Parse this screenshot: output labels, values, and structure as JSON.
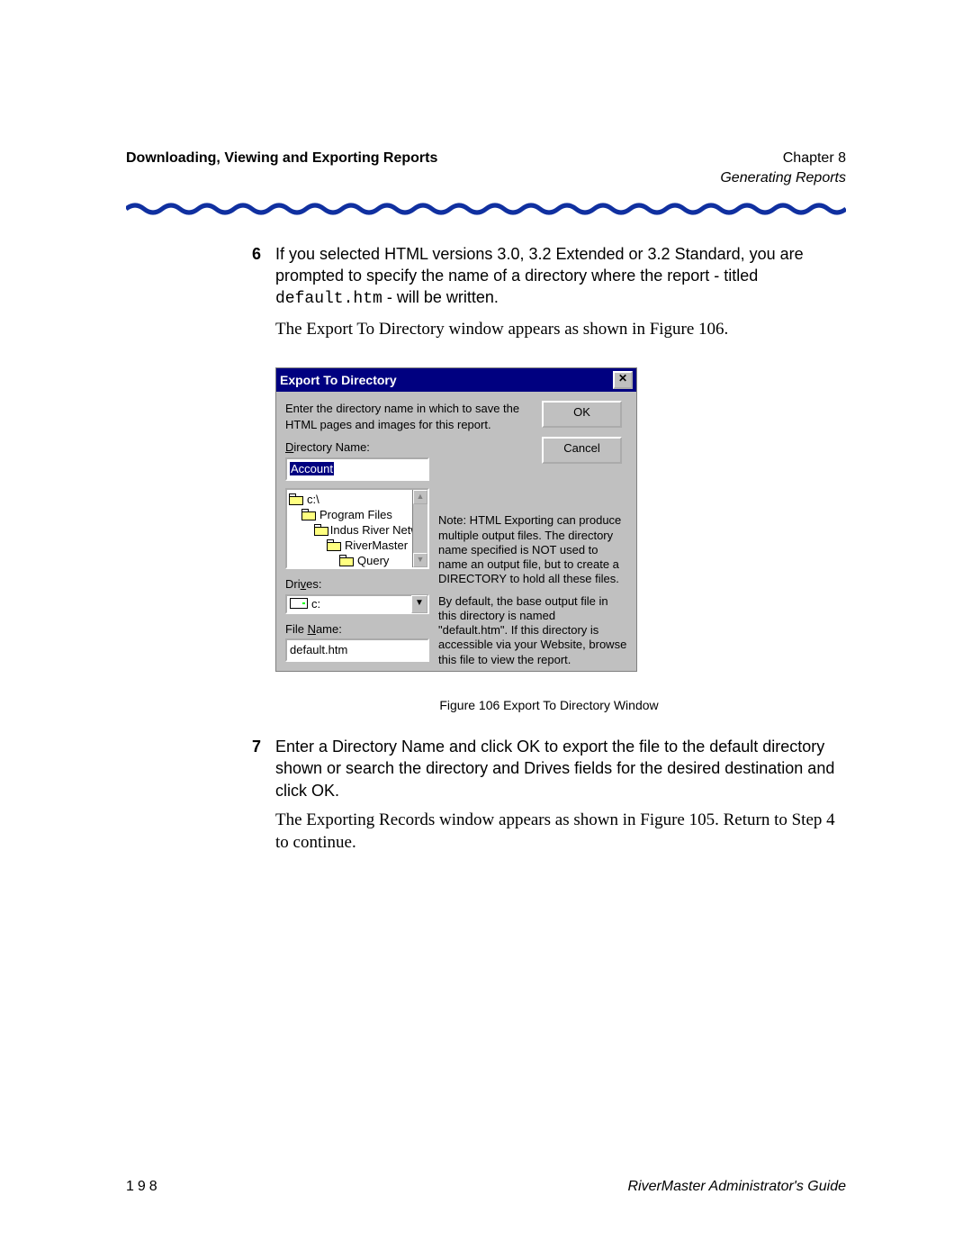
{
  "header": {
    "left": "Downloading, Viewing and Exporting Reports",
    "right_top": "Chapter 8",
    "right_sub": "Generating Reports"
  },
  "steps": {
    "s6": {
      "num": "6",
      "p1_a": "If you selected HTML versions 3.0, 3.2 Extended or 3.2 Standard, you are prompted to specify the name of a directory where the report - titled ",
      "p1_code": "default.htm",
      "p1_b": " - will be written.",
      "p2": "The Export To Directory window appears as shown in Figure 106."
    },
    "s7": {
      "num": "7",
      "p1": "Enter a Directory Name and click OK to export the file to the default directory shown or search the directory and Drives fields for the desired destination and click OK.",
      "p2": "The Exporting Records window appears as shown in Figure 105. Return to Step 4 to continue."
    }
  },
  "dialog": {
    "title": "Export To Directory",
    "instruction": "Enter the directory name in which to save the HTML pages and images for this report.",
    "ok": "OK",
    "cancel": "Cancel",
    "dir_label_pre": "D",
    "dir_label_post": "irectory Name:",
    "dir_value": "Account",
    "tree": {
      "root": "c:\\",
      "l1": "Program Files",
      "l2": "Indus River Netwo",
      "l3": "RiverMaster",
      "l4": "Query"
    },
    "drives_label_pre": "Dri",
    "drives_label_u": "v",
    "drives_label_post": "es:",
    "drive_value": "c:",
    "filename_label_pre": "File ",
    "filename_label_u": "N",
    "filename_label_post": "ame:",
    "filename_value": "default.htm",
    "note1": "Note: HTML Exporting can produce multiple output files. The directory name specified is NOT used to name an output file, but to create a DIRECTORY to hold all these files.",
    "note2": "By default, the base output file in this directory is named \"default.htm\". If this directory is accessible via your Website, browse this file to view the report."
  },
  "caption": "Figure 106   Export To Directory Window",
  "footer": {
    "page": "198",
    "book": "RiverMaster Administrator's Guide"
  }
}
